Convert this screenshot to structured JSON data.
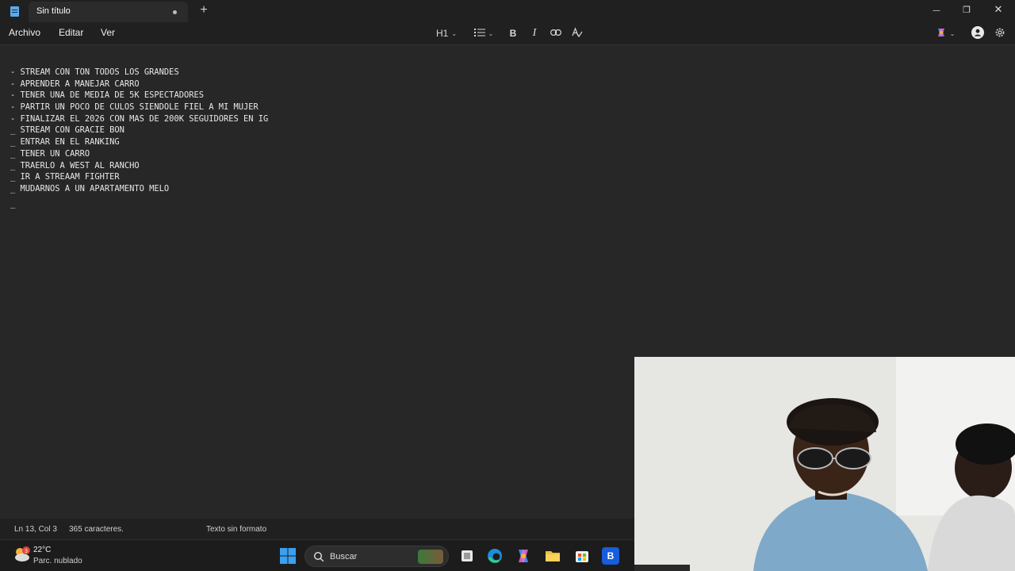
{
  "window": {
    "tab_title": "Sin título",
    "new_tab_symbol": "+",
    "minimize_symbol": "—",
    "maximize_symbol": "❐",
    "close_symbol": "✕"
  },
  "menu": {
    "file": "Archivo",
    "edit": "Editar",
    "view": "Ver"
  },
  "toolbar": {
    "heading_label": "H1",
    "bold_label": "B",
    "italic_label": "I"
  },
  "document": {
    "lines": [
      "- STREAM CON TON TODOS LOS GRANDES",
      "- APRENDER A MANEJAR CARRO",
      "- TENER UNA DE MEDIA DE 5K ESPECTADORES",
      "- PARTIR UN POCO DE CULOS SIENDOLE FIEL A MI MUJER",
      "- FINALIZAR EL 2026 CON MAS DE 200K SEGUIDORES EN IG",
      "_ STREAM CON GRACIE BON",
      "_ ENTRAR EN EL RANKING",
      "_ TENER UN CARRO",
      "_ TRAERLO A WEST AL RANCHO",
      "_ IR A STREAAM FIGHTER",
      "_ MUDARNOS A UN APARTAMENTO MELO",
      "",
      "_"
    ]
  },
  "status": {
    "position": "Ln 13, Col 3",
    "characters": "365 caracteres.",
    "format": "Texto sin formato"
  },
  "taskbar": {
    "temperature": "22°C",
    "weather": "Parc. nublado",
    "weather_badge": "3",
    "search_placeholder": "Buscar",
    "bitwarden_label": "B"
  },
  "colors": {
    "background": "#202020",
    "editor": "#272727",
    "notepad_icon": "#5aa9ee",
    "windows_start": "#3aa0f0"
  },
  "icons": [
    "notepad-icon",
    "list-icon",
    "link-icon",
    "spellcheck-icon",
    "copilot-icon",
    "account-icon",
    "settings-icon",
    "weather-icon",
    "windows-start-icon",
    "search-icon",
    "file-explorer-icon",
    "edge-icon",
    "copilot-app-icon",
    "folder-icon",
    "store-icon",
    "bitwarden-icon"
  ]
}
